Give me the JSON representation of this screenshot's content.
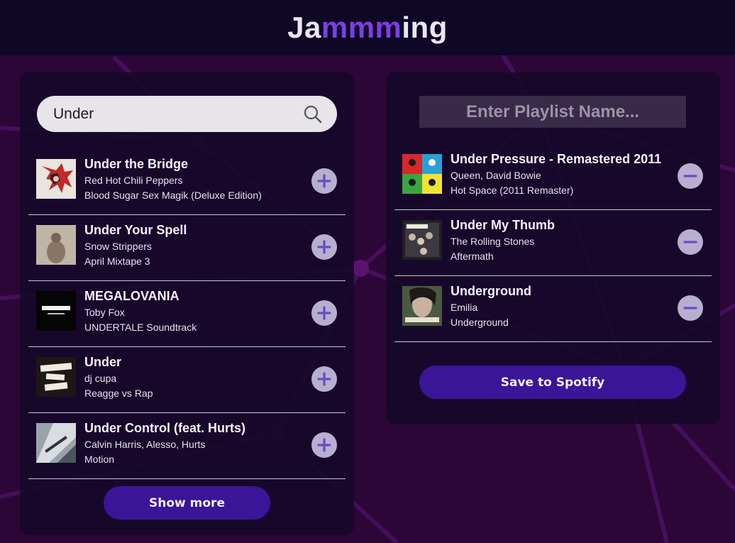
{
  "app": {
    "title_parts": [
      "Ja",
      "mmm",
      "ing"
    ]
  },
  "search": {
    "value": "Under",
    "icon": "search-icon"
  },
  "results": {
    "tracks": [
      {
        "name": "Under the Bridge",
        "artist": "Red Hot Chili Peppers",
        "album": "Blood Sugar Sex Magik (Deluxe Edition)"
      },
      {
        "name": "Under Your Spell",
        "artist": "Snow Strippers",
        "album": "April Mixtape 3"
      },
      {
        "name": "MEGALOVANIA",
        "artist": "Toby Fox",
        "album": "UNDERTALE Soundtrack"
      },
      {
        "name": "Under",
        "artist": "dj cupa",
        "album": "Reagge vs Rap"
      },
      {
        "name": "Under Control (feat. Hurts)",
        "artist": "Calvin Harris, Alesso, Hurts",
        "album": "Motion"
      }
    ],
    "add_icon": "plus-icon",
    "show_more_label": "Show more"
  },
  "playlist": {
    "name_placeholder": "Enter Playlist Name...",
    "tracks": [
      {
        "name": "Under Pressure - Remastered 2011",
        "artist": "Queen, David Bowie",
        "album": "Hot Space (2011 Remaster)"
      },
      {
        "name": "Under My Thumb",
        "artist": "The Rolling Stones",
        "album": "Aftermath"
      },
      {
        "name": "Underground",
        "artist": "Emilia",
        "album": "Underground"
      }
    ],
    "remove_icon": "minus-icon",
    "save_label": "Save to Spotify"
  },
  "colors": {
    "header_bg": "#0e0826",
    "page_bg": "#2a0636",
    "accent": "#7d3ee4",
    "button": "#3a1597",
    "action_circle": "#b7aed0"
  }
}
